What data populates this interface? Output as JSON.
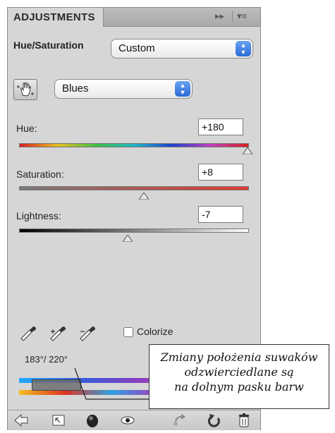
{
  "panel": {
    "tab_label": "ADJUSTMENTS",
    "expand_glyph": "▸▸",
    "menu_glyph": "▾≡",
    "adjustment_label": "Hue/Saturation",
    "preset": {
      "selected": "Custom"
    },
    "range": {
      "selected": "Blues"
    }
  },
  "sliders": [
    {
      "label": "Hue:",
      "value": "+180",
      "level_fraction": 1.0
    },
    {
      "label": "Saturation:",
      "value": "+8",
      "level_fraction": 0.52
    },
    {
      "label": "Lightness:",
      "value": "-7",
      "level_fraction": 0.465
    }
  ],
  "colorize": {
    "label": "Colorize",
    "checked": false
  },
  "range_readout": "183°/ 220°",
  "icons": [
    "hand-target-icon",
    "eyedropper-icon",
    "eyedropper-add-icon",
    "eyedropper-subtract-icon",
    "back-arrow-icon",
    "clip-layer-icon",
    "mask-icon",
    "eye-icon",
    "previous-state-icon",
    "reset-icon",
    "trash-icon"
  ],
  "colors": {
    "panel_bg": "#d6d6d6",
    "stepper_blue": "#2a6ad6",
    "slider_red": "#e23a30"
  },
  "annotation": {
    "lines": [
      "Zmiany położenia suwaków",
      "odzwierciedlane są",
      "na dolnym pasku barw"
    ]
  }
}
